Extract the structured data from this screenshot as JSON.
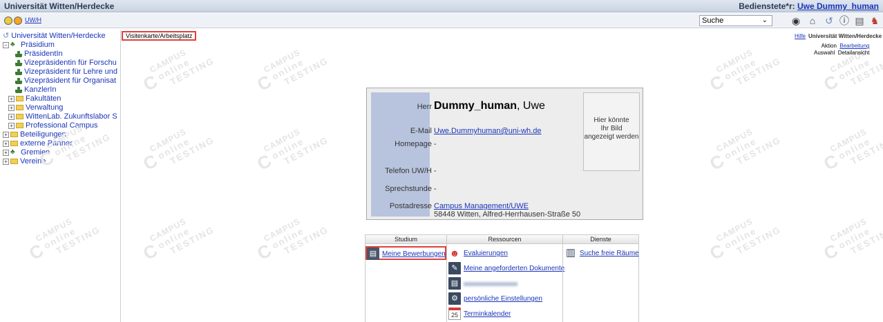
{
  "topbar": {
    "app_title": "Universität Witten/Herdecke",
    "staff_label": "Bedienstete*r:",
    "staff_name": "Uwe Dummy_human"
  },
  "secbar": {
    "org_link": "UW/H",
    "search_select_value": "Suche"
  },
  "tree": {
    "root": "Universität Witten/Herdecke",
    "items": [
      {
        "label": "Präsidium"
      },
      {
        "label": "PräsidentIn"
      },
      {
        "label": "Vizepräsidentin für Forschu"
      },
      {
        "label": "Vizepräsident für Lehre und"
      },
      {
        "label": "Vizepräsident für Organisat"
      },
      {
        "label": "KanzlerIn"
      },
      {
        "label": "Fakultäten"
      },
      {
        "label": "Verwaltung"
      },
      {
        "label": "WittenLab. Zukunftslabor S"
      },
      {
        "label": "Professional Campus"
      },
      {
        "label": "Beteiligungen"
      },
      {
        "label": "externe Partner"
      },
      {
        "label": "Gremien"
      },
      {
        "label": "Vereine"
      }
    ]
  },
  "main": {
    "breadcrumb": "Visitenkarte/Arbeitsplatz",
    "help_link": "Hilfe",
    "help_org": "Universität Witten/Herdecke",
    "action_label": "Aktion",
    "action_value": "Bearbeitung",
    "selection_label": "Auswahl",
    "selection_value": "Detailansicht"
  },
  "watermark": {
    "line1": "CAMPUS",
    "line2": "online",
    "line3": "TESTING"
  },
  "card": {
    "salutation": "Herr",
    "last_name": "Dummy_human",
    "first_name": ", Uwe",
    "email_label": "E-Mail",
    "email_value": "Uwe.Dummyhuman@uni-wh.de",
    "homepage_label": "Homepage",
    "homepage_value": "-",
    "phone_label": "Telefon  UW/H",
    "phone_value": "-",
    "office_hours_label": "Sprechstunde",
    "office_hours_value": "-",
    "address_label": "Postadresse",
    "address_link": "Campus Management/UWE",
    "address_line2": "58448 Witten, Alfred-Herrhausen-Straße 50",
    "photo_text_1": "Hier könnte",
    "photo_text_2": "Ihr Bild",
    "photo_text_3": "angezeigt werden"
  },
  "tiles": {
    "studium": {
      "header": "Studium",
      "items": [
        {
          "label": "Meine Bewerbungen",
          "icon": "document-icon"
        }
      ]
    },
    "ressourcen": {
      "header": "Ressourcen",
      "items": [
        {
          "label": "Evaluierungen",
          "icon": "evaluation-faces-icon"
        },
        {
          "label": "Meine angeforderten Dokumente",
          "icon": "document-request-icon"
        },
        {
          "label": "",
          "icon": "blurred-document-icon"
        },
        {
          "label": "persönliche Einstellungen",
          "icon": "settings-gears-icon"
        },
        {
          "label": "Terminkalender",
          "icon": "calendar-icon"
        }
      ]
    },
    "dienste": {
      "header": "Dienste",
      "items": [
        {
          "label": "Suche freie Räume",
          "icon": "building-search-icon"
        }
      ]
    },
    "calendar_day": "25"
  },
  "colors": {
    "link": "#1a35b8",
    "highlight": "#e0403a",
    "card_sidebar": "#b8c4de"
  }
}
